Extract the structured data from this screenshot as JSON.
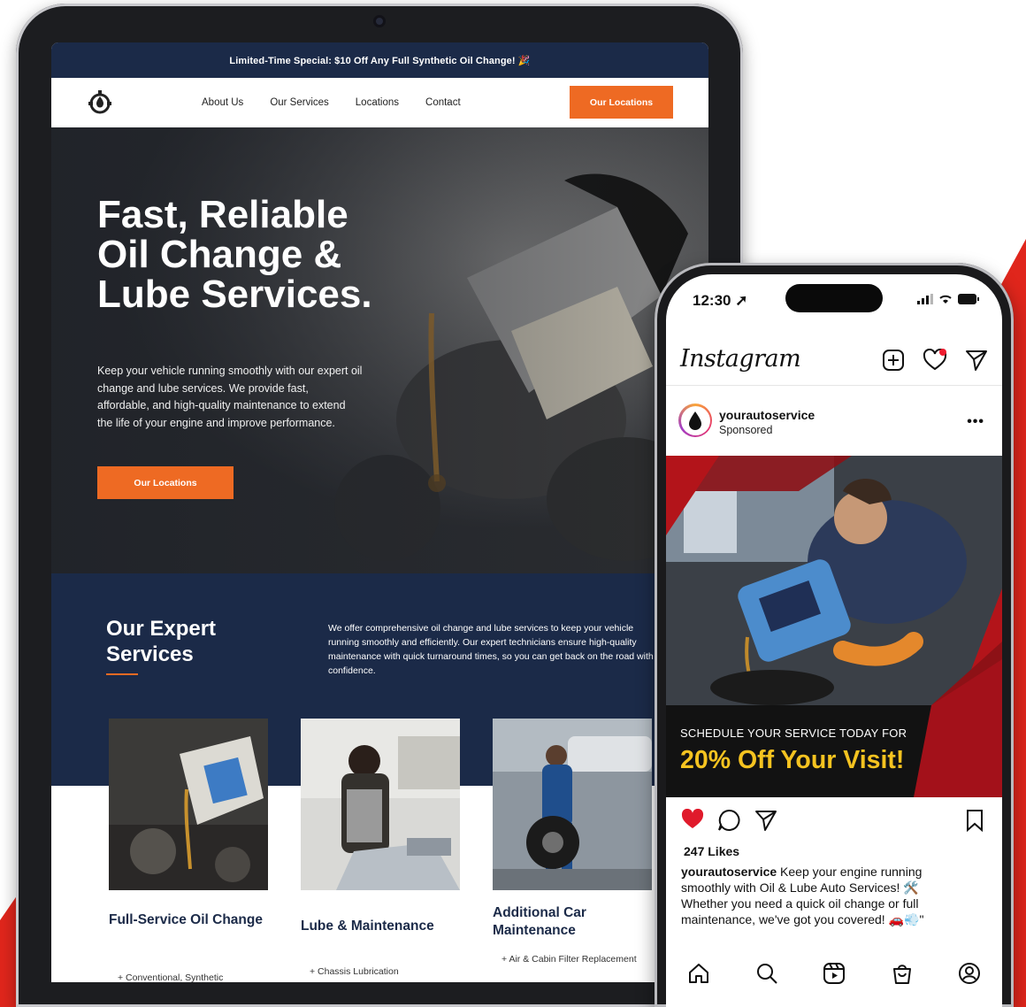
{
  "website": {
    "promo_bar": "Limited-Time Special: $10 Off Any Full Synthetic Oil Change! 🎉",
    "nav": {
      "links": [
        "About Us",
        "Our Services",
        "Locations",
        "Contact"
      ],
      "cta": "Our Locations"
    },
    "hero": {
      "title": "Fast, Reliable Oil Change & Lube Services.",
      "subtitle": "Keep your vehicle running smoothly with our expert oil change and lube services. We provide fast, affordable, and high-quality maintenance to extend the life of your engine and improve performance.",
      "cta": "Our Locations"
    },
    "services": {
      "title": "Our Expert Services",
      "description": "We offer comprehensive oil change and lube services to keep your vehicle running smoothly and efficiently. Our expert technicians ensure high-quality maintenance with quick turnaround times, so you can get back on the road with confidence.",
      "cards": [
        {
          "title": "Full-Service Oil Change",
          "bullet": "+  Conventional, Synthetic"
        },
        {
          "title": "Lube & Maintenance",
          "bullet": "+  Chassis Lubrication"
        },
        {
          "title": "Additional Car Maintenance",
          "bullet": "+  Air & Cabin Filter Replacement"
        }
      ]
    }
  },
  "phone": {
    "status": {
      "time": "12:30"
    },
    "app": {
      "logo": "Instagram"
    },
    "post": {
      "username": "yourautoservice",
      "sponsored": "Sponsored",
      "ad_kicker": "SCHEDULE YOUR SERVICE TODAY FOR",
      "ad_headline": "20% Off Your Visit!",
      "likes": "247 Likes",
      "caption_user": "yourautoservice",
      "caption_text": " Keep your engine running smoothly with Oil & Lube Auto Services! 🛠️ Whether you need a quick oil change or full maintenance, we've got you covered! 🚗💨\""
    }
  },
  "colors": {
    "navy": "#1b2a48",
    "orange": "#ee6a23",
    "red": "#e0261c",
    "ad_yellow": "#f5c320"
  },
  "icons": [
    "logo-icon",
    "plus-square-icon",
    "heart-icon",
    "send-icon",
    "more-icon",
    "like-heart-icon",
    "comment-icon",
    "share-icon",
    "bookmark-icon",
    "home-icon",
    "search-icon",
    "reels-icon",
    "shop-icon",
    "profile-icon",
    "droplet-icon"
  ]
}
